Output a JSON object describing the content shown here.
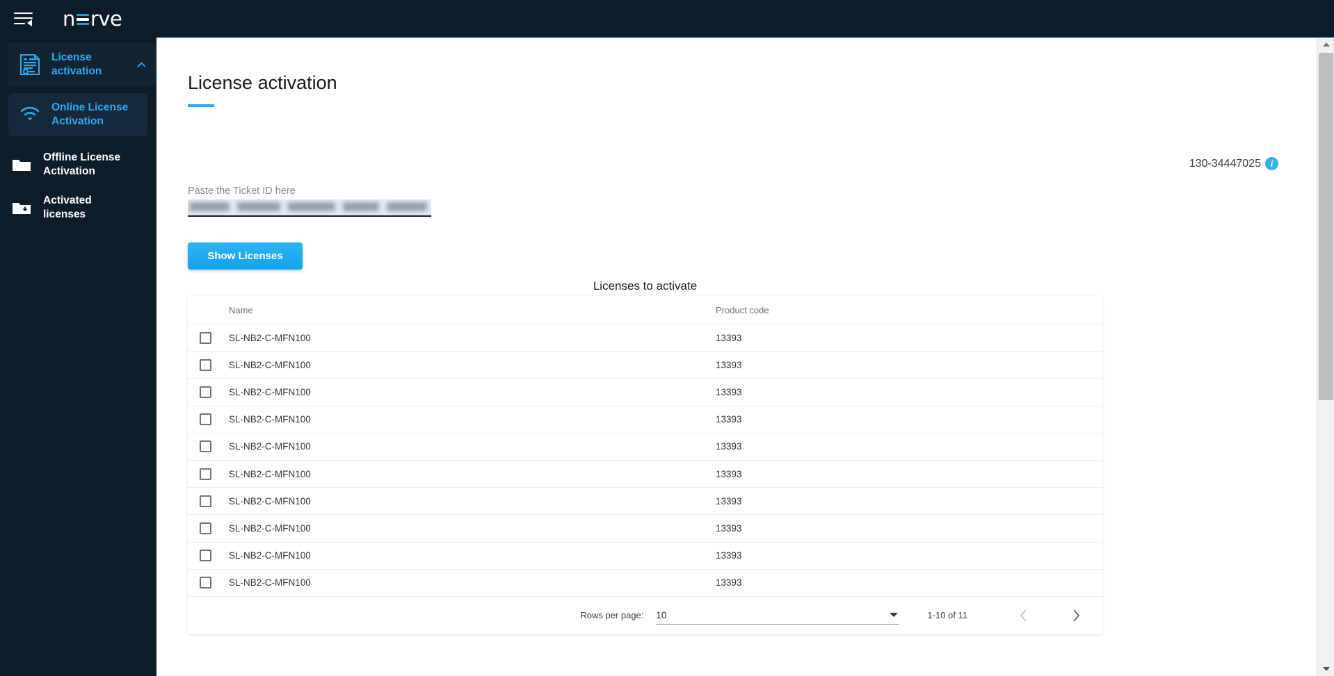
{
  "app": {
    "logo_pre": "n",
    "logo_post": "rve",
    "menu_icon": "menu-collapse-icon"
  },
  "sidebar": {
    "items": [
      {
        "label": "License activation",
        "icon": "document-certificate-icon",
        "state": "group-expanded"
      },
      {
        "label": "Online License Activation",
        "icon": "wifi-icon",
        "state": "active"
      },
      {
        "label": "Offline License Activation",
        "icon": "folder-icon",
        "state": "default"
      },
      {
        "label": "Activated licenses",
        "icon": "folder-download-icon",
        "state": "default"
      }
    ]
  },
  "main": {
    "page_title": "License activation",
    "serial_number": "130-34447025",
    "info_glyph": "i",
    "ticket_field": {
      "label": "Paste the Ticket ID here",
      "value": "",
      "placeholder": ""
    },
    "show_button": "Show Licenses",
    "table_caption": "Licenses to activate",
    "table": {
      "columns": [
        "Name",
        "Product code"
      ],
      "rows": [
        {
          "checked": false,
          "name": "SL-NB2-C-MFN100",
          "code": "13393"
        },
        {
          "checked": false,
          "name": "SL-NB2-C-MFN100",
          "code": "13393"
        },
        {
          "checked": false,
          "name": "SL-NB2-C-MFN100",
          "code": "13393"
        },
        {
          "checked": false,
          "name": "SL-NB2-C-MFN100",
          "code": "13393"
        },
        {
          "checked": false,
          "name": "SL-NB2-C-MFN100",
          "code": "13393"
        },
        {
          "checked": false,
          "name": "SL-NB2-C-MFN100",
          "code": "13393"
        },
        {
          "checked": false,
          "name": "SL-NB2-C-MFN100",
          "code": "13393"
        },
        {
          "checked": false,
          "name": "SL-NB2-C-MFN100",
          "code": "13393"
        },
        {
          "checked": false,
          "name": "SL-NB2-C-MFN100",
          "code": "13393"
        },
        {
          "checked": false,
          "name": "SL-NB2-C-MFN100",
          "code": "13393"
        }
      ]
    },
    "pagination": {
      "rows_per_page_label": "Rows per page:",
      "rows_per_page_value": "10",
      "range": "1-10 of 11",
      "prev_enabled": false,
      "next_enabled": true
    }
  },
  "colors": {
    "brand_dark": "#0c1c29",
    "accent_blue": "#2fa8f5",
    "button_blue": "#13a2ee",
    "text_dark": "#1b1b1b"
  }
}
